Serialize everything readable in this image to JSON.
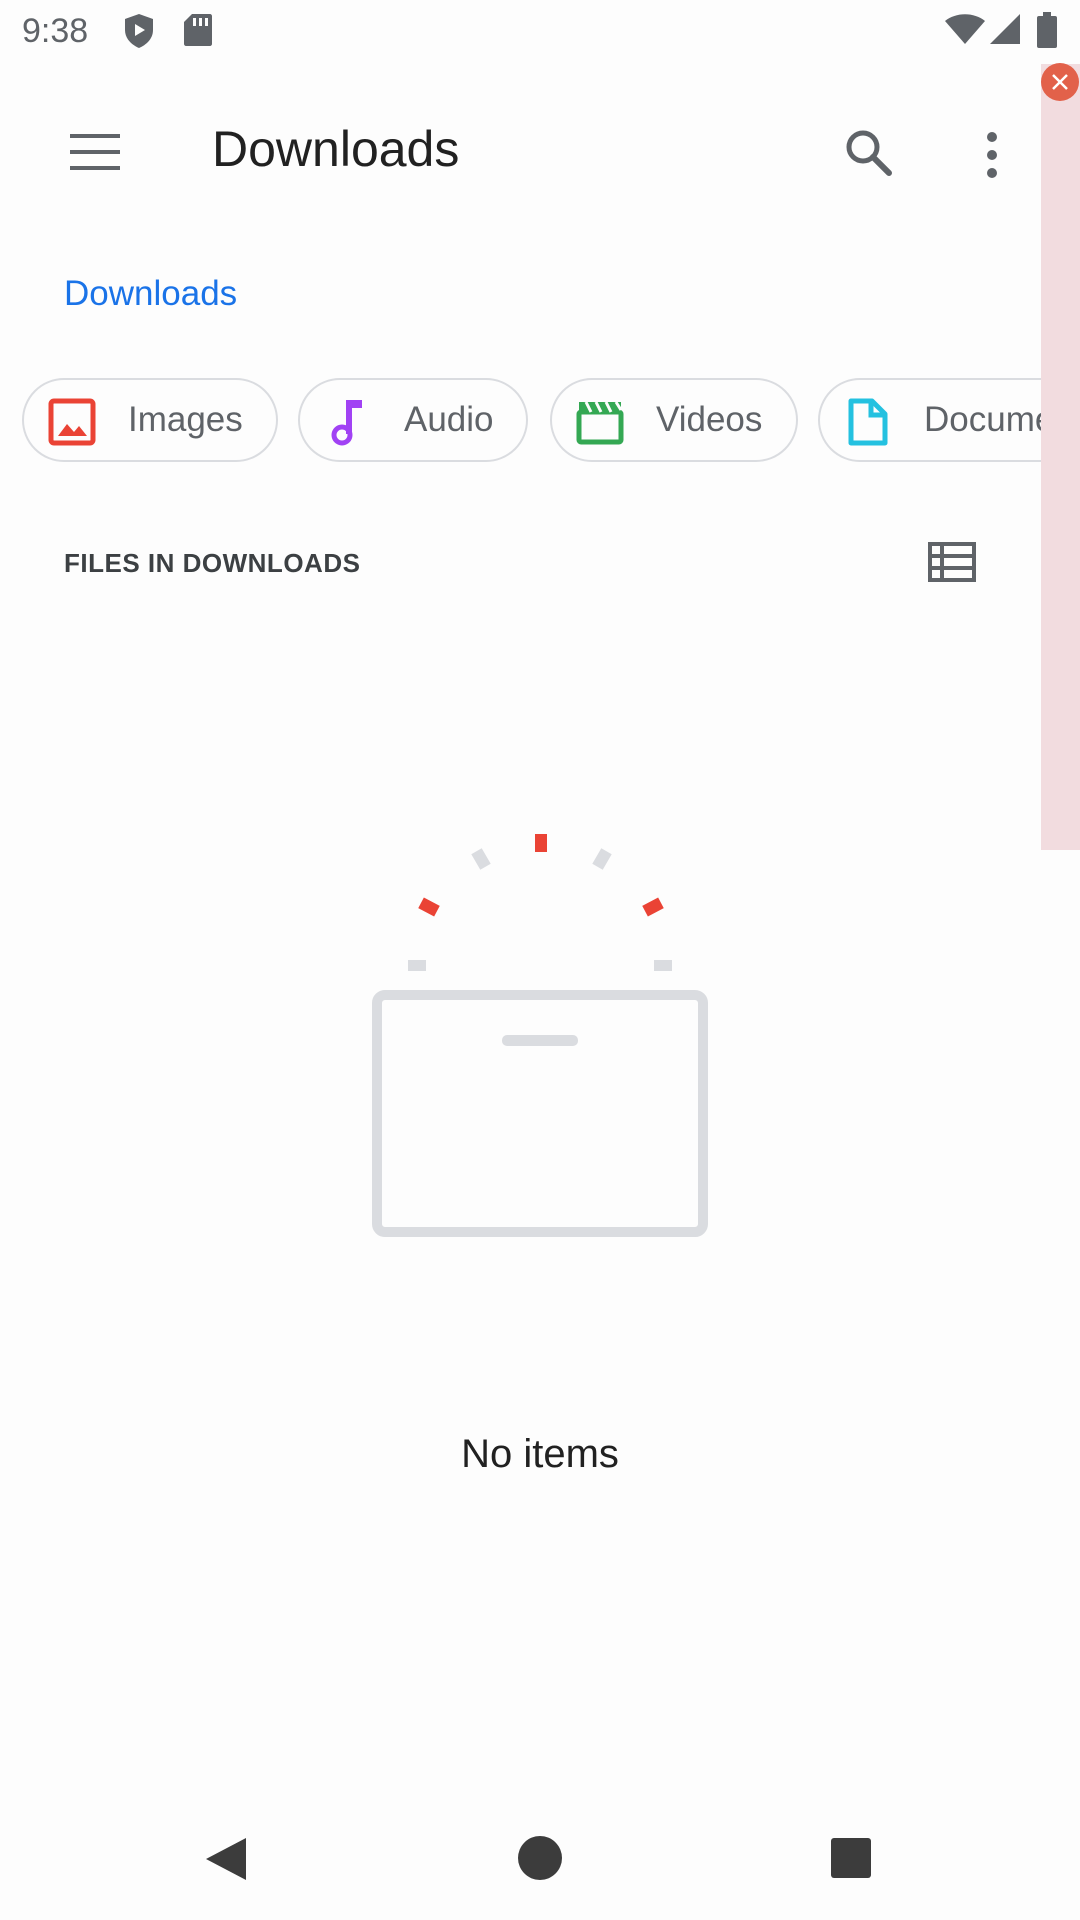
{
  "status_bar": {
    "time": "9:38",
    "left_icons": [
      "shield-icon",
      "sd-card-icon"
    ],
    "right_icons": [
      "wifi-icon",
      "signal-icon",
      "battery-icon"
    ]
  },
  "app_bar": {
    "title": "Downloads",
    "menu_icon": "hamburger-menu-icon",
    "search_icon": "search-icon",
    "more_icon": "more-vert-icon"
  },
  "breadcrumb": "Downloads",
  "chips": [
    {
      "label": "Images",
      "icon": "image-icon",
      "color": "#ea4335"
    },
    {
      "label": "Audio",
      "icon": "music-note-icon",
      "color": "#a142f4"
    },
    {
      "label": "Videos",
      "icon": "movie-icon",
      "color": "#34a853"
    },
    {
      "label": "Documents",
      "icon": "document-icon",
      "color": "#24c1e0"
    }
  ],
  "section": {
    "title": "FILES IN DOWNLOADS",
    "view_toggle_icon": "list-view-icon"
  },
  "empty_state": {
    "message": "No items",
    "illustration": "empty-box-illustration",
    "accent": "#ea4335",
    "neutral": "#dadce0"
  },
  "overlay": {
    "close_icon": "close-icon",
    "color": "#e2614a"
  },
  "nav_bar": {
    "back_icon": "back-triangle-icon",
    "home_icon": "home-circle-icon",
    "recent_icon": "recents-square-icon"
  }
}
